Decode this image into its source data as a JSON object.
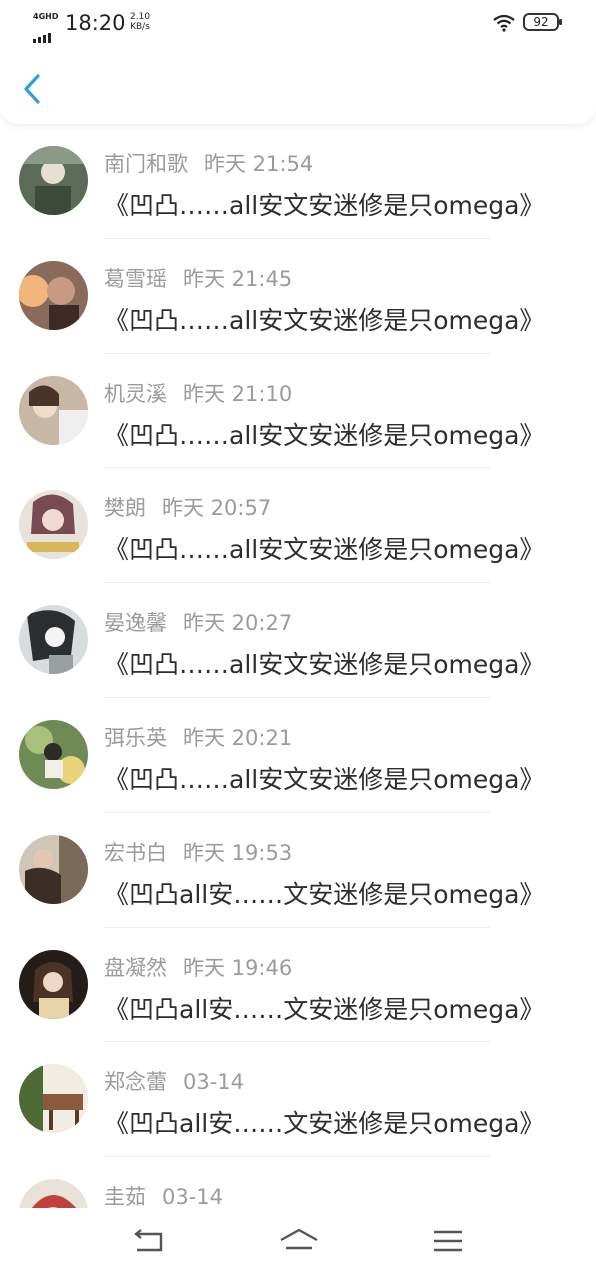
{
  "status_bar": {
    "network": "4GHD",
    "time": "18:20",
    "speed_value": "2.10",
    "speed_unit": "KB/s",
    "battery": "92"
  },
  "header": {
    "back_icon": "chevron-left-icon",
    "accent_color": "#2d9fde"
  },
  "messages": [
    {
      "name": "南门和歌",
      "time": "昨天 21:54",
      "preview": "《凹凸……all安文安迷修是只omega》",
      "avatar_tone": "#5c6b58"
    },
    {
      "name": "葛雪瑶",
      "time": "昨天 21:45",
      "preview": "《凹凸……all安文安迷修是只omega》",
      "avatar_tone": "#8a6a5a"
    },
    {
      "name": "机灵溪",
      "time": "昨天 21:10",
      "preview": "《凹凸……all安文安迷修是只omega》",
      "avatar_tone": "#c7b8a6"
    },
    {
      "name": "樊朗",
      "time": "昨天 20:57",
      "preview": "《凹凸……all安文安迷修是只omega》",
      "avatar_tone": "#b38a8e"
    },
    {
      "name": "晏逸馨",
      "time": "昨天 20:27",
      "preview": "《凹凸……all安文安迷修是只omega》",
      "avatar_tone": "#7e8484"
    },
    {
      "name": "弭乐英",
      "time": "昨天 20:21",
      "preview": "《凹凸……all安文安迷修是只omega》",
      "avatar_tone": "#6f8a55"
    },
    {
      "name": "宏书白",
      "time": "昨天 19:53",
      "preview": "《凹凸all安……文安迷修是只omega》",
      "avatar_tone": "#6b5a4a"
    },
    {
      "name": "盘凝然",
      "time": "昨天 19:46",
      "preview": "《凹凸all安……文安迷修是只omega》",
      "avatar_tone": "#3d2f2a"
    },
    {
      "name": "郑念蕾",
      "time": "03-14",
      "preview": "《凹凸all安……文安迷修是只omega》",
      "avatar_tone": "#6f7c45"
    },
    {
      "name": "圭茹",
      "time": "03-14",
      "preview": "",
      "avatar_tone": "#b8504a"
    }
  ],
  "nav_bar": {
    "back": "back-icon",
    "home": "home-icon",
    "menu": "menu-icon"
  }
}
